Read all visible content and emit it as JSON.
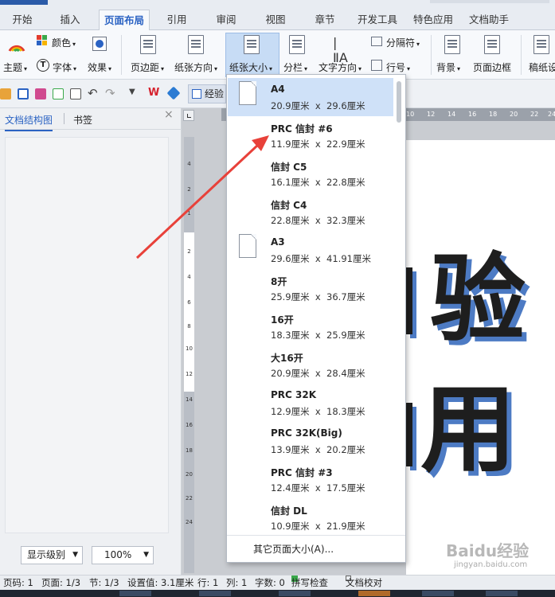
{
  "tabs": [
    {
      "label": "开始",
      "active": false
    },
    {
      "label": "插入",
      "active": false
    },
    {
      "label": "页面布局",
      "active": true
    },
    {
      "label": "引用",
      "active": false
    },
    {
      "label": "审阅",
      "active": false
    },
    {
      "label": "视图",
      "active": false
    },
    {
      "label": "章节",
      "active": false
    },
    {
      "label": "开发工具",
      "active": false
    },
    {
      "label": "特色应用",
      "active": false
    },
    {
      "label": "文档助手",
      "active": false
    }
  ],
  "ribbon": {
    "theme": "主题",
    "color": "颜色",
    "font": "字体",
    "effect": "效果",
    "margin": "页边距",
    "orientation": "纸张方向",
    "paper_size": "纸张大小",
    "columns": "分栏",
    "text_direction": "文字方向",
    "separator": "分隔符",
    "line_number": "行号",
    "background": "背景",
    "page_border": "页面边框",
    "draft": "稿纸设"
  },
  "quickbar": {
    "exp_label": "经验"
  },
  "nav": {
    "tab_structure": "文档结构图",
    "tab_bookmark": "书签",
    "level_combo": "显示级别",
    "zoom_combo": "100%"
  },
  "document": {
    "char1": "验",
    "char2": "用"
  },
  "paper_menu": {
    "selected_index": 0,
    "options": [
      {
        "name": "A4",
        "dims": "20.9厘米  x  29.6厘米"
      },
      {
        "name": "PRC 信封 #6",
        "dims": "11.9厘米  x  22.9厘米"
      },
      {
        "name": "信封 C5",
        "dims": "16.1厘米  x  22.8厘米"
      },
      {
        "name": "信封 C4",
        "dims": "22.8厘米  x  32.3厘米"
      },
      {
        "name": "A3",
        "dims": "29.6厘米  x  41.91厘米"
      },
      {
        "name": "8开",
        "dims": "25.9厘米  x  36.7厘米"
      },
      {
        "name": "16开",
        "dims": "18.3厘米  x  25.9厘米"
      },
      {
        "name": "大16开",
        "dims": "20.9厘米  x  28.4厘米"
      },
      {
        "name": "PRC 32K",
        "dims": "12.9厘米  x  18.3厘米"
      },
      {
        "name": "PRC 32K(Big)",
        "dims": "13.9厘米  x  20.2厘米"
      },
      {
        "name": "PRC 信封 #3",
        "dims": "12.4厘米  x  17.5厘米"
      },
      {
        "name": "信封 DL",
        "dims": "10.9厘米  x  21.9厘米"
      }
    ],
    "more": "其它页面大小(A)..."
  },
  "status": {
    "page_code": "页码: 1",
    "page": "页面: 1/3",
    "section": "节: 1/3",
    "setting": "设置值: 3.1厘米",
    "row": "行: 1",
    "col": "列: 1",
    "wordcount": "字数: 0",
    "spellcheck": "拼写检查",
    "proofread": "文档校对"
  },
  "watermark": {
    "text": "Baidu经验",
    "url": "jingyan.baidu.com"
  },
  "colors": {
    "accent": "#2b63c3",
    "arrow": "#e8413a",
    "selected_row": "#cfe1f8",
    "text_shadow": "#4d7bc4"
  },
  "icons": [
    "theme-icon",
    "color-icon",
    "font-icon",
    "effect-icon",
    "margin-icon",
    "orientation-icon",
    "paper-size-icon",
    "columns-icon",
    "text-direction-icon",
    "separator-icon",
    "line-number-icon",
    "background-icon",
    "page-border-icon",
    "draft-icon",
    "folder-icon",
    "save-icon",
    "print-icon",
    "preview-icon",
    "undo-icon",
    "redo-icon",
    "wps-icon",
    "cube-icon",
    "close-icon"
  ]
}
